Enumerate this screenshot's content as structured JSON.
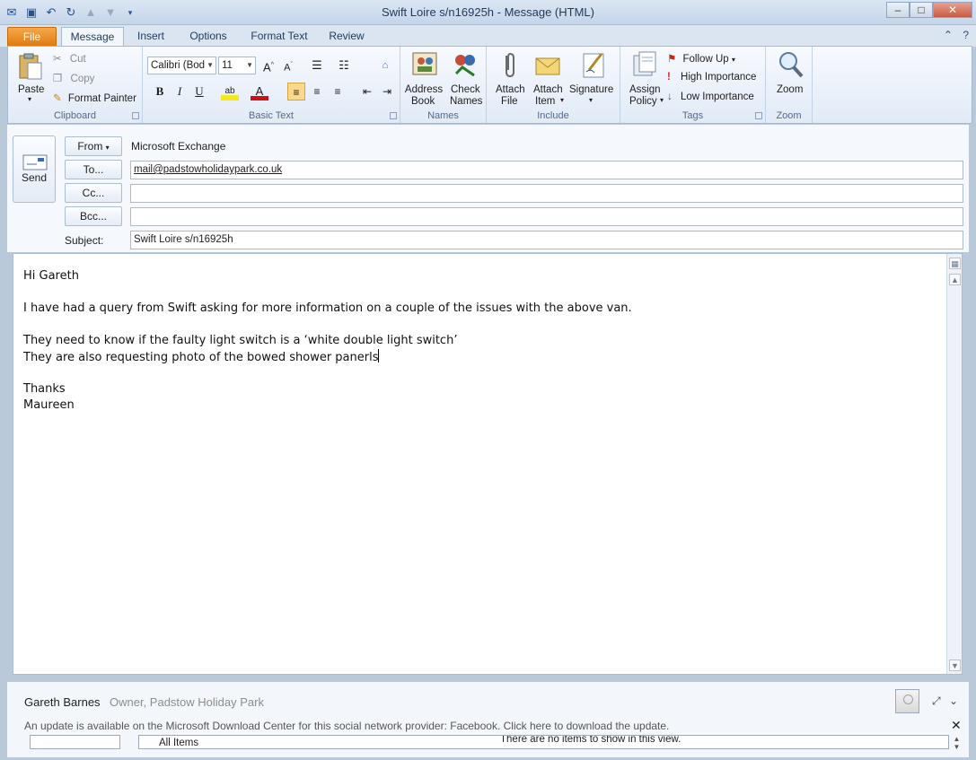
{
  "window": {
    "title": "Swift Loire  s/n16925h  - Message (HTML)",
    "qat_icons": [
      "outlook-icon",
      "save-icon",
      "undo-icon",
      "redo-icon",
      "up-arrow-icon",
      "down-arrow-icon",
      "customize-qat-icon"
    ]
  },
  "tabs": [
    "File",
    "Message",
    "Insert",
    "Options",
    "Format Text",
    "Review"
  ],
  "active_tab": "Message",
  "ribbon": {
    "clipboard": {
      "label": "Clipboard",
      "paste": "Paste",
      "cut": "Cut",
      "copy": "Copy",
      "format_painter": "Format Painter"
    },
    "basic_text": {
      "label": "Basic Text",
      "font": "Calibri (Bod",
      "size": "11"
    },
    "names": {
      "label": "Names",
      "address_book_1": "Address",
      "address_book_2": "Book",
      "check_names_1": "Check",
      "check_names_2": "Names"
    },
    "include": {
      "label": "Include",
      "attach_file_1": "Attach",
      "attach_file_2": "File",
      "attach_item_1": "Attach",
      "attach_item_2": "Item",
      "signature": "Signature"
    },
    "tags": {
      "label": "Tags",
      "assign_policy_1": "Assign",
      "assign_policy_2": "Policy",
      "follow_up": "Follow Up",
      "high_importance": "High Importance",
      "low_importance": "Low Importance"
    },
    "zoom": {
      "label": "Zoom",
      "zoom": "Zoom"
    }
  },
  "compose": {
    "send": "Send",
    "from_button": "From",
    "from_value": "Microsoft Exchange",
    "to_button": "To...",
    "to_value": "mail@padstowholidaypark.co.uk",
    "cc_button": "Cc...",
    "cc_value": "",
    "bcc_button": "Bcc...",
    "bcc_value": "",
    "subject_label": "Subject:",
    "subject_value": "Swift Loire  s/n16925h"
  },
  "body_lines": [
    "Hi Gareth",
    "",
    "I have had a query from Swift asking for more information on a couple of the issues with the above van.",
    "",
    "They need to know if the faulty light switch is a ‘white double light switch’",
    "They are also requesting photo of the bowed shower panerls",
    "",
    "Thanks",
    "Maureen"
  ],
  "people_pane": {
    "name": "Gareth Barnes",
    "title": "Owner, Padstow Holiday Park",
    "update_notice": "An update is available on the Microsoft Download Center for this social network provider: Facebook. Click here to download the update.",
    "all_items": "All Items",
    "no_items": "There are no items to show in this view."
  }
}
